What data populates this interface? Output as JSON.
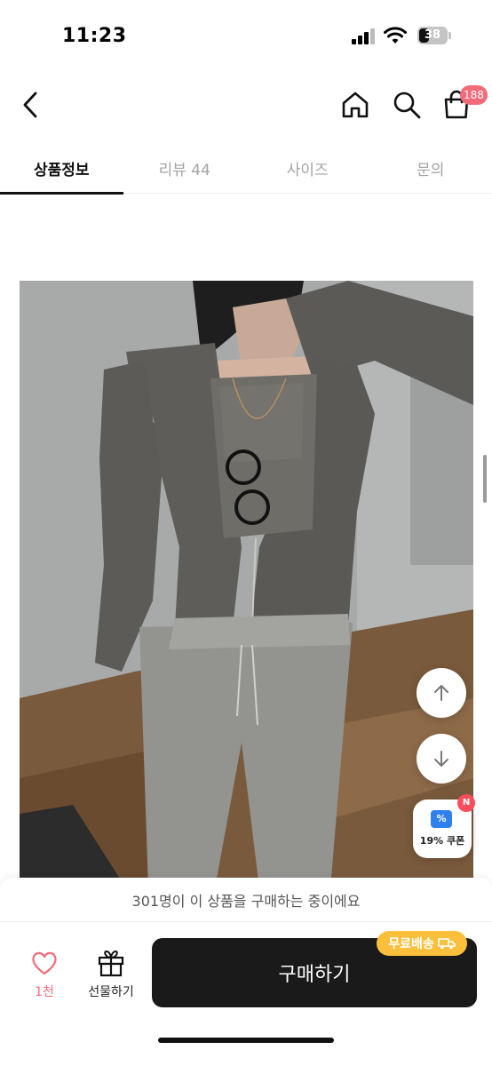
{
  "status_bar": {
    "time": "11:23",
    "battery": "38",
    "battery_level": 0.38,
    "icons": [
      "signal-icon",
      "wifi-icon",
      "battery-icon"
    ]
  },
  "header": {
    "icons": [
      "back-icon",
      "home-icon",
      "search-icon",
      "cart-icon"
    ],
    "cart_count": "188"
  },
  "tabs": [
    {
      "label": "상품정보",
      "active": true
    },
    {
      "label": "리뷰 44",
      "active": false
    },
    {
      "label": "사이즈",
      "active": false
    },
    {
      "label": "문의",
      "active": false
    }
  ],
  "floating": {
    "icons": [
      "arrow-up-icon",
      "arrow-down-icon",
      "coupon-icon"
    ],
    "coupon_label": "19% 쿠폰",
    "coupon_badge": "N"
  },
  "bottom_bar": {
    "buyers_text": "301명이 이 상품을 구매하는 중이에요",
    "like_count": "1천",
    "gift_label": "선물하기",
    "buy_label": "구매하기",
    "free_shipping": "무료배송",
    "icons": [
      "heart-icon",
      "gift-icon",
      "truck-icon"
    ]
  },
  "colors": {
    "accent_pink": "#f26b7a",
    "buy_button": "#1a1a1a",
    "free_shipping": "#fbbf3c",
    "coupon_blue": "#2f80ed"
  }
}
